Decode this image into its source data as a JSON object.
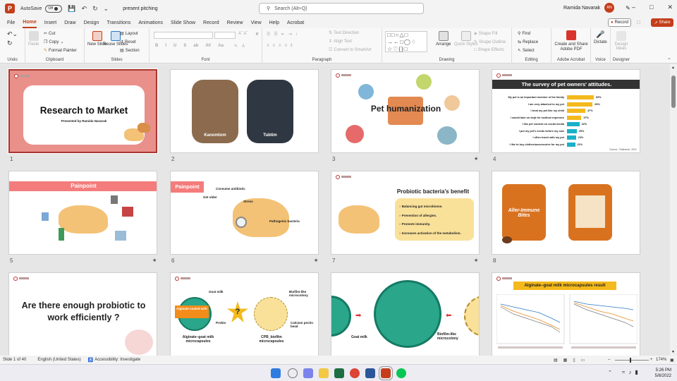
{
  "app": {
    "autosave_label": "AutoSave",
    "autosave_state": "Off",
    "file_name": "present pitching",
    "search_placeholder": "Search (Alt+Q)",
    "user_name": "Ramida Navarak",
    "user_initials": "RN"
  },
  "tabs": [
    "File",
    "Home",
    "Insert",
    "Draw",
    "Design",
    "Transitions",
    "Animations",
    "Slide Show",
    "Record",
    "Review",
    "View",
    "Help",
    "Acrobat"
  ],
  "active_tab": "Home",
  "record_label": "Record",
  "share_label": "Share",
  "ribbon": {
    "undo": {
      "label": "Undo"
    },
    "clipboard": {
      "label": "Clipboard",
      "paste": "Paste",
      "cut": "Cut",
      "copy": "Copy",
      "format_painter": "Format Painter"
    },
    "slides": {
      "label": "Slides",
      "new_slide": "New Slide",
      "reuse_slides": "Reuse Slides",
      "layout": "Layout",
      "reset": "Reset",
      "section": "Section"
    },
    "font": {
      "label": "Font",
      "buttons": [
        "B",
        "I",
        "U",
        "S",
        "ab",
        "AV",
        "Aa"
      ]
    },
    "paragraph": {
      "label": "Paragraph",
      "text_direction": "Text Direction",
      "align_text": "Align Text",
      "smartart": "Convert to SmartArt"
    },
    "drawing": {
      "label": "Drawing",
      "arrange": "Arrange",
      "quick_styles": "Quick Styles",
      "shape_fill": "Shape Fill",
      "shape_outline": "Shape Outline",
      "shape_effects": "Shape Effects"
    },
    "editing": {
      "label": "Editing",
      "find": "Find",
      "replace": "Replace",
      "select": "Select"
    },
    "acrobat": {
      "label": "Adobe Acrobat",
      "create_share": "Create and Share Adobe PDF"
    },
    "voice": {
      "label": "Voice",
      "dictate": "Dictate"
    },
    "designer": {
      "label": "Designer",
      "design_ideas": "Design Ideas"
    }
  },
  "slides": [
    {
      "num": "1",
      "title": "Research to Market",
      "subtitle": "Presented by Ramida Navarak"
    },
    {
      "num": "2",
      "labels": [
        "Kanomtom",
        "Tubtim"
      ]
    },
    {
      "num": "3",
      "title": "Pet humanization"
    },
    {
      "num": "4",
      "title": "The survey of pet owners' attitudes.",
      "source": "Source : Rakbento, 2021",
      "bars": [
        {
          "label": "My pet is an important member of the family",
          "value": 69,
          "text": "69%"
        },
        {
          "label": "I am very attached to my pet",
          "value": 66,
          "text": "66%"
        },
        {
          "label": "I treat my pet like my child",
          "value": 47,
          "text": "47%"
        },
        {
          "label": "I would take on dept for medical expenses",
          "value": 37,
          "text": "37%"
        },
        {
          "label": "I like pet content on social media",
          "value": 32,
          "text": "32%"
        },
        {
          "label": "I put my pet's needs before my own",
          "value": 25,
          "text": "25%"
        },
        {
          "label": "I often travel with my pet",
          "value": 23,
          "text": "23%"
        },
        {
          "label": "I like to buy clothes/accessories for my pet",
          "value": 21,
          "text": "21%"
        }
      ]
    },
    {
      "num": "5",
      "title": "Painpoint"
    },
    {
      "num": "6",
      "title": "Painpoint",
      "labels": [
        "Consume antibiotic",
        "Get older",
        "Stress",
        "Pathogenic bacteria"
      ]
    },
    {
      "num": "7",
      "title": "Probiotic bacteria's benefit",
      "points": [
        "Balancing gut microbiome.",
        "Prevention of allergies.",
        "Promote immunity.",
        "Increases activation of the metabolism."
      ]
    },
    {
      "num": "8",
      "product": "Aller-Immune Bites"
    },
    {
      "num": "9",
      "title": "Are there enough probiotic to work efficiently ?"
    },
    {
      "num": "10",
      "labels": [
        "Goat milk",
        "Biofilm-like microcolony",
        "Alginate coated with",
        "Probio",
        "Alginate–goat milk microcapsules",
        "CPB_biofilm microcapsules",
        "Calcium pectin bead"
      ],
      "qmark": "?"
    },
    {
      "num": "11",
      "labels": [
        "Goat milk",
        "Biofilm-like microcolony"
      ]
    },
    {
      "num": "12",
      "title": "Alginate–goat milk microcapsules result"
    }
  ],
  "status": {
    "slide_info": "Slide 1 of 40",
    "language": "English (United States)",
    "accessibility": "Accessibility: Investigate",
    "zoom": "174%"
  },
  "taskbar": {
    "time": "5:26 PM",
    "date": "5/8/2022"
  },
  "colors": {
    "accent": "#c43e1c",
    "slide_pink": "#e9908a",
    "bar_gold": "#f4b91c",
    "bar_teal": "#1bb0c8",
    "salmon": "#f47c7c",
    "yellow_box": "#f9e19a"
  }
}
